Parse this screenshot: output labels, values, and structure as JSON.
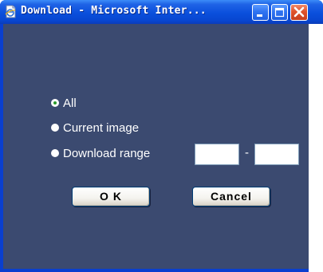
{
  "window": {
    "title": "Download - Microsoft Inter...",
    "icon": "internet-explorer-page-icon",
    "controls": [
      "minimize",
      "maximize",
      "close"
    ],
    "colors": {
      "titlebar": "#0a4fdc",
      "content_bg": "#3b4a70",
      "close": "#e0522b"
    }
  },
  "options": [
    {
      "label": "All",
      "selected": true
    },
    {
      "label": "Current image",
      "selected": false
    },
    {
      "label": "Download range",
      "selected": false
    }
  ],
  "range": {
    "from_value": "",
    "to_value": "",
    "separator": "-"
  },
  "buttons": {
    "ok_label": "O K",
    "cancel_label": "Cancel"
  }
}
